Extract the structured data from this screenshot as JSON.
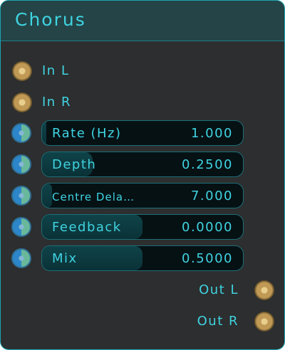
{
  "node": {
    "title": "Chorus",
    "inputs": [
      {
        "label": "In L",
        "icon": "audio-port-icon"
      },
      {
        "label": "In R",
        "icon": "audio-port-icon"
      }
    ],
    "params": [
      {
        "label": "Rate (Hz)",
        "value": "1.000",
        "fill_fraction": 0.02
      },
      {
        "label": "Depth",
        "value": "0.2500",
        "fill_fraction": 0.25
      },
      {
        "label": "Centre Dela…",
        "value": "7.000",
        "fill_fraction": 0.05
      },
      {
        "label": "Feedback",
        "value": "0.0000",
        "fill_fraction": 0.5
      },
      {
        "label": "Mix",
        "value": "0.5000",
        "fill_fraction": 0.5
      }
    ],
    "outputs": [
      {
        "label": "Out L",
        "icon": "audio-port-icon"
      },
      {
        "label": "Out R",
        "icon": "audio-port-icon"
      }
    ]
  },
  "colors": {
    "accent": "#3fd3e0",
    "header_bg": "#244447",
    "body_bg": "#2c2e2f",
    "slider_bg": "#061114",
    "slider_fill": "#0f4349",
    "audio_port": "#c09a55"
  }
}
